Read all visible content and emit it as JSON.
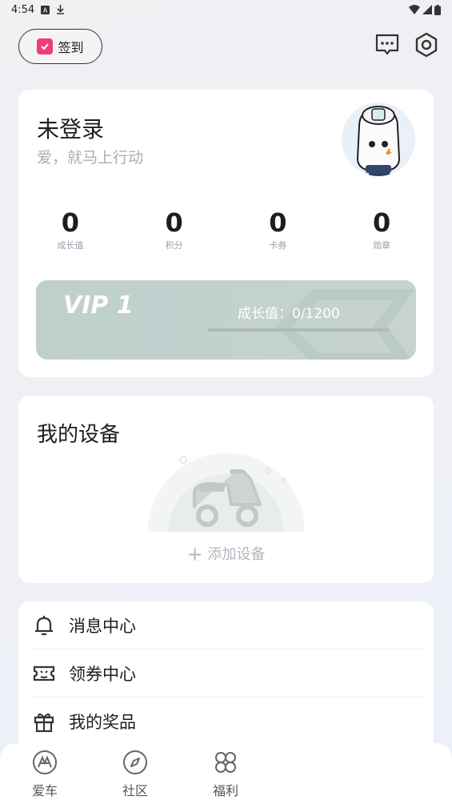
{
  "status_bar": {
    "time": "4:54"
  },
  "header": {
    "checkin_label": "签到"
  },
  "user_card": {
    "name": "未登录",
    "slogan": "爱，就马上行动",
    "stats": [
      {
        "value": "0",
        "label": "成长值"
      },
      {
        "value": "0",
        "label": "积分"
      },
      {
        "value": "0",
        "label": "卡券"
      },
      {
        "value": "0",
        "label": "勋章"
      }
    ]
  },
  "vip": {
    "level": "VIP 1",
    "growth_text": "成长值：0/1200",
    "progress_fraction": 0
  },
  "devices": {
    "title": "我的设备",
    "add_label": "添加设备"
  },
  "menu": {
    "items": [
      {
        "label": "消息中心",
        "icon": "bell-icon"
      },
      {
        "label": "领券中心",
        "icon": "coupon-icon"
      },
      {
        "label": "我的奖品",
        "icon": "gift-icon"
      }
    ]
  },
  "tabs": [
    {
      "label": "爱车",
      "icon": "car-logo-icon"
    },
    {
      "label": "社区",
      "icon": "compass-icon"
    },
    {
      "label": "福利",
      "icon": "clover-icon"
    }
  ],
  "colors": {
    "accent_pink": "#f03c7a",
    "vip_bg": "#c2d1cf",
    "text_primary": "#1d1d22",
    "text_muted": "#a8adb8"
  }
}
